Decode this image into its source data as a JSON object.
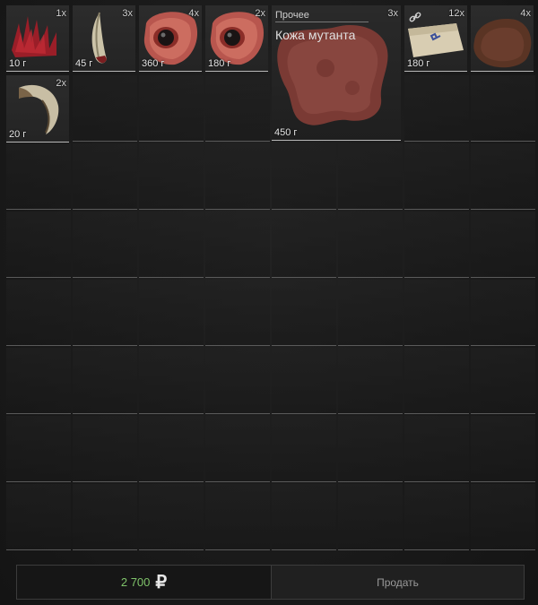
{
  "inventory": {
    "items": [
      {
        "icon": "red-spikes-icon",
        "count": "1x",
        "weight": "10 г"
      },
      {
        "icon": "claw-icon",
        "count": "3x",
        "weight": "45 г"
      },
      {
        "icon": "mutant-eye-icon",
        "count": "4x",
        "weight": "360 г"
      },
      {
        "icon": "mutant-eye-icon",
        "count": "2x",
        "weight": "180 г"
      },
      {
        "icon": "mutant-skin-icon",
        "category": "Прочее",
        "name": "Кожа мутанта",
        "count": "3x",
        "weight": "450 г"
      },
      {
        "icon": "map-document-icon",
        "count": "12x",
        "weight": "180 г",
        "linked": true
      },
      {
        "icon": "fur-pelt-icon",
        "count": "4x",
        "weight": ""
      },
      {
        "icon": "horn-icon",
        "count": "2x",
        "weight": "20 г"
      }
    ]
  },
  "footer": {
    "price": "2 700",
    "currency_symbol": "₽",
    "sell_label": "Продать"
  },
  "colors": {
    "price_green": "#7fc36a",
    "grid_line": "#5a5a5a",
    "item_underline": "#b8b8b8"
  }
}
